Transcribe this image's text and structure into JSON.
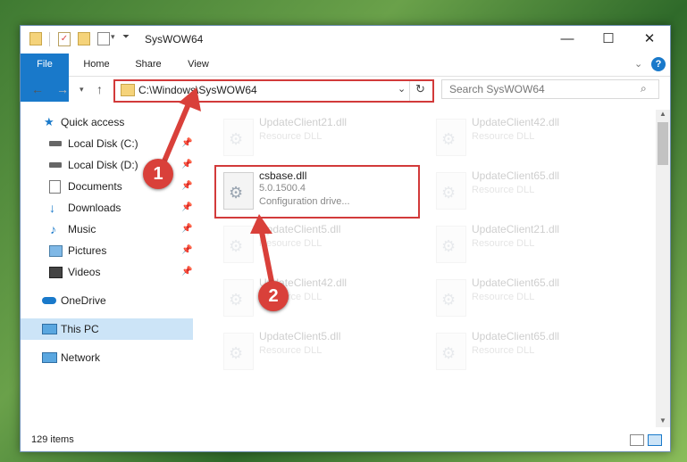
{
  "window": {
    "title": "SysWOW64",
    "minimize": "—",
    "maximize": "☐",
    "close": "✕"
  },
  "ribbon": {
    "tabs": [
      "File",
      "Home",
      "Share",
      "View"
    ],
    "help": "?"
  },
  "address": {
    "path": "C:\\Windows\\SysWOW64",
    "search_placeholder": "Search SysWOW64"
  },
  "sidebar": {
    "items": [
      {
        "label": "Quick access",
        "icon": "star-icon"
      },
      {
        "label": "Local Disk (C:)",
        "icon": "drive-icon",
        "pinned": true
      },
      {
        "label": "Local Disk (D:)",
        "icon": "drive-icon",
        "pinned": true
      },
      {
        "label": "Documents",
        "icon": "documents-icon",
        "pinned": true
      },
      {
        "label": "Downloads",
        "icon": "download-icon",
        "pinned": true
      },
      {
        "label": "Music",
        "icon": "music-icon",
        "pinned": true
      },
      {
        "label": "Pictures",
        "icon": "pictures-icon",
        "pinned": true
      },
      {
        "label": "Videos",
        "icon": "videos-icon",
        "pinned": true
      },
      {
        "label": "OneDrive",
        "icon": "cloud-icon"
      },
      {
        "label": "This PC",
        "icon": "computer-icon",
        "selected": true
      },
      {
        "label": "Network",
        "icon": "network-icon"
      }
    ]
  },
  "files": {
    "left": [
      {
        "name": "UpdateClient21.dll",
        "desc": "Resource DLL"
      },
      {
        "name": "csbase.dll",
        "version": "5.0.1500.4",
        "desc": "Configuration drive..."
      },
      {
        "name": "UpdateClient5.dll",
        "desc": "Resource DLL"
      },
      {
        "name": "UpdateClient42.dll",
        "desc": "Resource DLL"
      },
      {
        "name": "UpdateClient5.dll",
        "desc": "Resource DLL"
      }
    ],
    "right": [
      {
        "name": "UpdateClient42.dll",
        "desc": "Resource DLL"
      },
      {
        "name": "UpdateClient65.dll",
        "desc": "Resource DLL"
      },
      {
        "name": "UpdateClient21.dll",
        "desc": "Resource DLL"
      },
      {
        "name": "UpdateClient65.dll",
        "desc": "Resource DLL"
      },
      {
        "name": "UpdateClient65.dll",
        "desc": "Resource DLL"
      }
    ]
  },
  "status": {
    "count": "129 items"
  },
  "annotations": {
    "step1": "1",
    "step2": "2",
    "color": "#d9403a"
  }
}
